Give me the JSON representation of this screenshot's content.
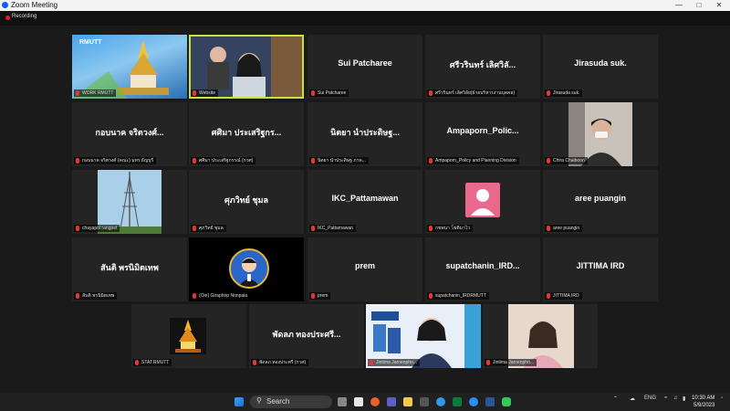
{
  "window": {
    "title": "Zoom Meeting"
  },
  "recording": {
    "label": "Recording"
  },
  "participants": [
    {
      "display": "",
      "label": "WORK RMUTT"
    },
    {
      "display": "",
      "label": "Website"
    },
    {
      "display": "Sui Patcharee",
      "label": "Sui Patcharee"
    },
    {
      "display": "ศรีวรินทร์ เลิศวิลั...",
      "label": "ศรีวรินทร์ เลิศวิลัย(ฝ่ายบริหารงานบุคคล)"
    },
    {
      "display": "Jirasuda suk.",
      "label": "Jirasuda suk."
    },
    {
      "display": "กอบนาค จริตวงศ์...",
      "label": "กอบนาค จริตวงศ์ (คณะ) มทร.ธัญบุรี"
    },
    {
      "display": "ศศิมา ประเสริฐกร...",
      "label": "ศศิมา ประเสริฐกรรณ์ (กวศ)"
    },
    {
      "display": "นิตยา นำประดิษฐ...",
      "label": "นิตยา นำประดิษฐ ภาค..."
    },
    {
      "display": "Ampaporn_Polic...",
      "label": "Ampaporn_Policy and Planning Division"
    },
    {
      "display": "",
      "label": "Chira Chaiboon"
    },
    {
      "display": "",
      "label": "chayapol rangpet"
    },
    {
      "display": "ศุภวิทย์ ชุมล",
      "label": "ศุภวิทย์ ชุมล"
    },
    {
      "display": "IKC_Pattamawan",
      "label": "IKC_Pattamawan"
    },
    {
      "display": "",
      "label": "กชพนา โชติมาไว"
    },
    {
      "display": "aree puangin",
      "label": "aree puangin"
    },
    {
      "display": "สันติ พรนิมิตเทพ",
      "label": "สันติ พรนิมิตเทพ"
    },
    {
      "display": "",
      "label": "(Oie) Giraphop Nonpala"
    },
    {
      "display": "prem",
      "label": "prem"
    },
    {
      "display": "supatchanin_IRD...",
      "label": "supatchanin_IRDRMUTT"
    },
    {
      "display": "JITTIMA IRD",
      "label": "JITTIMA IRD"
    },
    {
      "display": "",
      "label": "STAT.RMUTT"
    },
    {
      "display": "พัดลภ ทองประศรี...",
      "label": "พัดลภ ทองประศรี (กวศ)"
    },
    {
      "display": "",
      "label": "Jintima Jaroenpho..."
    },
    {
      "display": "",
      "label": "Jintima Jaroenpho..."
    }
  ],
  "tile_media": {
    "work_logo_text": "RMUTT"
  },
  "taskbar": {
    "search_placeholder": "Search",
    "clock_time": "10:30 AM",
    "clock_date": "5/9/2023",
    "lang": "ENG"
  },
  "colors": {
    "active_speaker": "#c9e23a",
    "mic_muted": "#e33333",
    "recording": "#e02020"
  }
}
